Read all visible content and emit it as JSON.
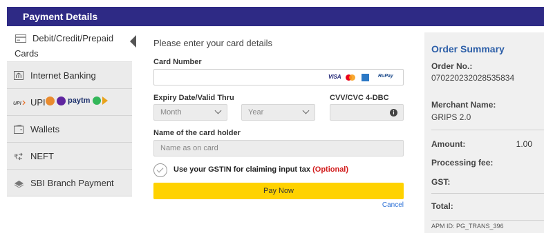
{
  "header": {
    "title": "Payment Details"
  },
  "sidebar": {
    "items": [
      {
        "label_line1": "Debit/Credit/Prepaid",
        "label_line2": "Cards",
        "icon": "card-icon"
      },
      {
        "label": "Internet Banking",
        "icon": "bank-icon"
      },
      {
        "label": "UPI",
        "icon": "upi-icon",
        "app_logos": [
          "phonepe-icon",
          "paytm-icon"
        ],
        "paytm_text": "paytm"
      },
      {
        "label": "Wallets",
        "icon": "wallet-icon"
      },
      {
        "label": "NEFT",
        "icon": "neft-icon"
      },
      {
        "label": "SBI Branch Payment",
        "icon": "branch-icon"
      }
    ]
  },
  "form": {
    "intro": "Please enter your card details",
    "card_number_label": "Card Number",
    "card_logos": [
      "VISA",
      "RuPay"
    ],
    "expiry_label": "Expiry Date/Valid Thru",
    "month_value": "Month",
    "year_value": "Year",
    "cvv_label": "CVV/CVC 4-DBC",
    "holder_label": "Name of the card holder",
    "holder_placeholder": "Name as on card",
    "gstin_text": "Use your GSTIN for claiming input tax ",
    "gstin_optional": "(Optional)",
    "pay_button": "Pay Now",
    "cancel": "Cancel"
  },
  "summary": {
    "title": "Order Summary",
    "order_no_label": "Order No.:",
    "order_no": "070220232028535834",
    "merchant_label": "Merchant Name:",
    "merchant": "GRIPS 2.0",
    "amount_label": "Amount:",
    "amount": "1.00",
    "processing_label": "Processing fee:",
    "gst_label": "GST:",
    "total_label": "Total:",
    "apm": "APM ID: PG_TRANS_396"
  },
  "colors": {
    "header": "#2e2a85",
    "pay_button": "#ffd200",
    "summary_title": "#2d5fa8",
    "optional": "#d21c1c"
  }
}
